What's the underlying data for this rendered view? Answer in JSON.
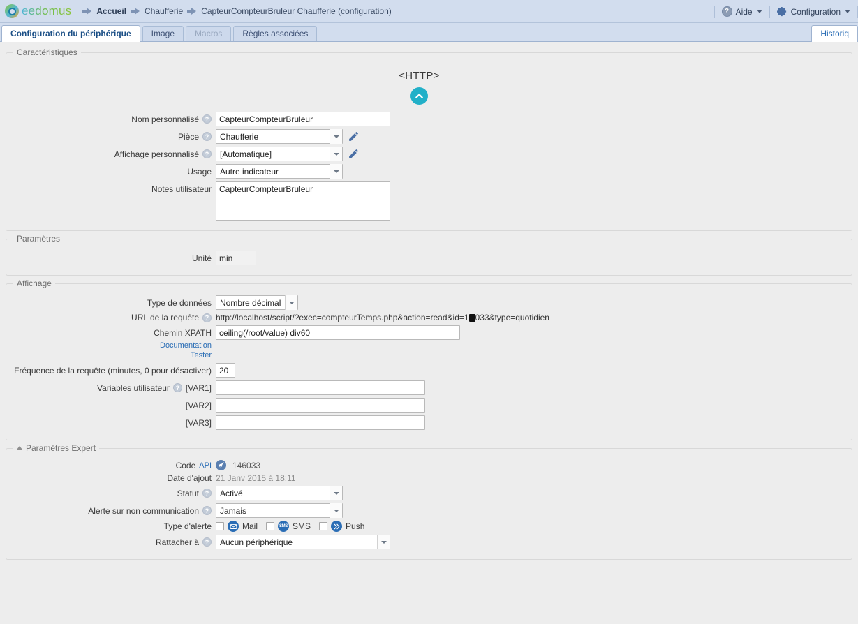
{
  "header": {
    "logo_text": "eedomus",
    "logo_icon": "eedomus-ring-logo",
    "breadcrumbs": [
      {
        "label": "Accueil",
        "bold": true
      },
      {
        "label": "Chaufferie",
        "bold": false
      },
      {
        "label": "CapteurCompteurBruleur Chaufferie (configuration)",
        "bold": false
      }
    ],
    "help_label": "Aide",
    "config_label": "Configuration"
  },
  "tabs": {
    "items": [
      {
        "label": "Configuration du périphérique",
        "state": "active"
      },
      {
        "label": "Image",
        "state": "normal"
      },
      {
        "label": "Macros",
        "state": "disabled"
      },
      {
        "label": "Règles associées",
        "state": "normal"
      }
    ],
    "right_tab": "Historiq"
  },
  "caracteristiques": {
    "legend": "Caractéristiques",
    "device_type": "<HTTP>",
    "device_icon": "chevron-up-circle-icon",
    "nom_label": "Nom personnalisé",
    "nom_value": "CapteurCompteurBruleur",
    "piece_label": "Pièce",
    "piece_value": "Chaufferie",
    "affichage_label": "Affichage personnalisé",
    "affichage_value": "[Automatique]",
    "usage_label": "Usage",
    "usage_value": "Autre indicateur",
    "notes_label": "Notes utilisateur",
    "notes_value": "CapteurCompteurBruleur"
  },
  "parametres": {
    "legend": "Paramètres",
    "unite_label": "Unité",
    "unite_value": "min"
  },
  "affichage": {
    "legend": "Affichage",
    "type_label": "Type de données",
    "type_value": "Nombre décimal",
    "url_label": "URL de la requête",
    "url_value_before": "http://localhost/script/?exec=compteurTemps.php&action=read&id=1",
    "url_value_after": "033&type=quotidien",
    "xpath_label": "Chemin XPATH",
    "xpath_value": "ceiling(/root/value) div60",
    "doc_link": "Documentation",
    "test_link": "Tester",
    "freq_label": "Fréquence de la requête (minutes, 0 pour désactiver)",
    "freq_value": "20",
    "vars_label": "Variables utilisateur",
    "var1_label": "[VAR1]",
    "var1_value": "",
    "var2_label": "[VAR2]",
    "var2_value": "",
    "var3_label": "[VAR3]",
    "var3_value": ""
  },
  "expert": {
    "legend": "Paramètres Expert",
    "code_label": "Code",
    "code_api_word": "API",
    "code_value": "146033",
    "date_label": "Date d'ajout",
    "date_value": "21 Janv 2015 à 18:11",
    "statut_label": "Statut",
    "statut_value": "Activé",
    "alerte_label": "Alerte sur non communication",
    "alerte_value": "Jamais",
    "type_alerte_label": "Type d'alerte",
    "alerts": [
      {
        "name": "Mail",
        "icon": "mail-icon"
      },
      {
        "name": "SMS",
        "icon": "sms-icon"
      },
      {
        "name": "Push",
        "icon": "push-icon"
      }
    ],
    "rattacher_label": "Rattacher à",
    "rattacher_value": "Aucun périphérique"
  },
  "colors": {
    "header_bg": "#d2ddee",
    "accent_teal": "#22b0c8",
    "link_blue": "#2a6db5",
    "page_bg": "#ededed"
  }
}
